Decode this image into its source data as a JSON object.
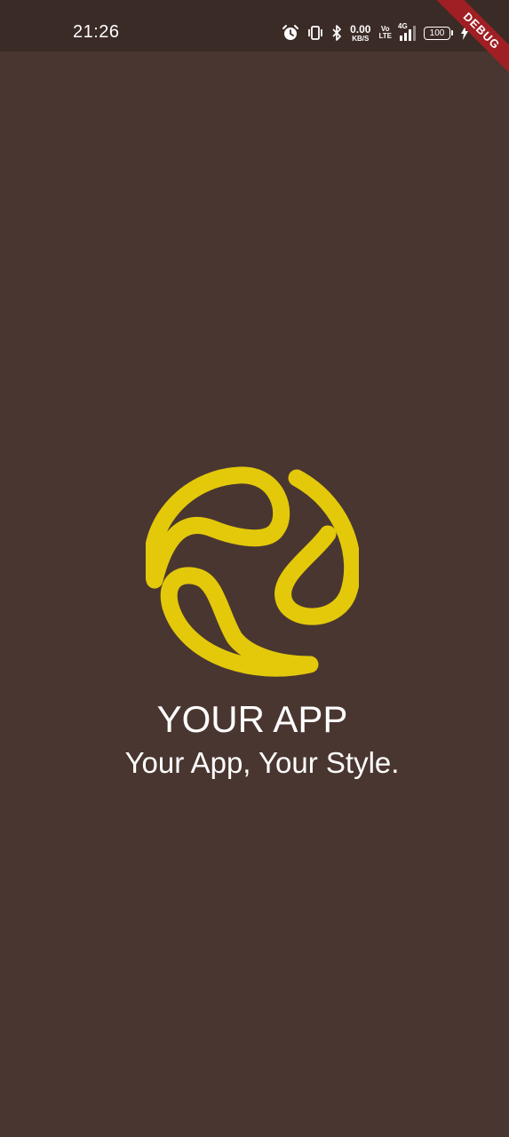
{
  "status_bar": {
    "time": "21:26",
    "net_speed_value": "0.00",
    "net_speed_unit": "KB/S",
    "volte_top": "Vo",
    "volte_bottom": "LTE",
    "network_type": "4G",
    "battery_level": "100",
    "icons": [
      "alarm-icon",
      "vibrate-icon",
      "bluetooth-icon",
      "signal-icon",
      "battery-icon",
      "charging-icon"
    ]
  },
  "debug_banner": "DEBUG",
  "splash": {
    "title": "YOUR APP",
    "tagline": "Your App, Your Style.",
    "logo_icon": "swirl-logo-icon"
  },
  "colors": {
    "background": "#4a3630",
    "status_bar": "#3b2b26",
    "logo": "#e3c90a",
    "debug_ribbon": "#a01f24",
    "text": "#ffffff"
  }
}
